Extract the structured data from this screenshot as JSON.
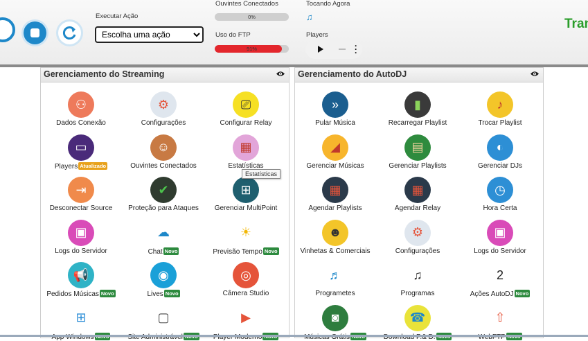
{
  "header": {
    "action_label": "Executar Ação",
    "action_select": "Escolha uma ação",
    "listeners_label": "Ouvintes Conectados",
    "listeners_percent": "0%",
    "listeners_fraction": 0,
    "ftp_label": "Uso do FTP",
    "ftp_percent": "91%",
    "ftp_fraction": 0.91,
    "playing_label": "Tocando Agora",
    "players_label": "Players",
    "right_text": "Tran",
    "colors": {
      "accent_blue": "#1e88c9",
      "ftp_bar": "#e3262c",
      "green_text": "#2a9d2a"
    }
  },
  "streaming": {
    "title": "Gerenciamento do Streaming",
    "tiles": [
      {
        "label": "Dados Conexão",
        "icon": "connection-icon"
      },
      {
        "label": "Configurações",
        "icon": "gear-icon"
      },
      {
        "label": "Configurar Relay",
        "icon": "relay-icon"
      },
      {
        "label": "Players",
        "icon": "player-icon",
        "badge": "Atualizado"
      },
      {
        "label": "Ouvintes Conectados",
        "icon": "listeners-icon"
      },
      {
        "label": "Estatísticas",
        "icon": "stats-icon"
      },
      {
        "label": "Desconectar Source",
        "icon": "disconnect-icon"
      },
      {
        "label": "Proteção para Ataques",
        "icon": "shield-icon"
      },
      {
        "label": "Gerenciar MultiPoint",
        "icon": "multipoint-icon"
      },
      {
        "label": "Logs do Servidor",
        "icon": "logs-icon"
      },
      {
        "label": "Chat",
        "icon": "chat-icon",
        "badge": "Novo"
      },
      {
        "label": "Previsão Tempo",
        "icon": "weather-icon",
        "badge": "Novo"
      },
      {
        "label": "Pedidos Músicas",
        "icon": "megaphone-icon",
        "badge": "Novo"
      },
      {
        "label": "Lives",
        "icon": "live-icon",
        "badge": "Novo"
      },
      {
        "label": "Câmera Studio",
        "icon": "camera-icon"
      },
      {
        "label": "App Windows",
        "icon": "windows-icon",
        "badge": "Novo"
      },
      {
        "label": "Site Administrável",
        "icon": "site-icon",
        "badge": "Novo"
      },
      {
        "label": "Player Moderno",
        "icon": "modern-player-icon",
        "badge": "Novo"
      }
    ],
    "tooltip": "Estatísticas"
  },
  "autodj": {
    "title": "Gerenciamento do AutoDJ",
    "tiles": [
      {
        "label": "Pular Música",
        "icon": "skip-icon"
      },
      {
        "label": "Recarregar Playlist",
        "icon": "reload-playlist-icon"
      },
      {
        "label": "Trocar Playlist",
        "icon": "swap-playlist-icon"
      },
      {
        "label": "Gerenciar Músicas",
        "icon": "music-manage-icon"
      },
      {
        "label": "Gerenciar Playlists",
        "icon": "playlist-manage-icon"
      },
      {
        "label": "Gerenciar DJs",
        "icon": "dj-icon"
      },
      {
        "label": "Agendar Playlists",
        "icon": "calendar-icon"
      },
      {
        "label": "Agendar Relay",
        "icon": "calendar-icon"
      },
      {
        "label": "Hora Certa",
        "icon": "clock-icon"
      },
      {
        "label": "Vinhetas & Comerciais",
        "icon": "jingle-icon"
      },
      {
        "label": "Configurações",
        "icon": "gear-icon"
      },
      {
        "label": "Logs do Servidor",
        "icon": "logs-icon"
      },
      {
        "label": "Programetes",
        "icon": "programs-icon"
      },
      {
        "label": "Programas",
        "icon": "music-note-icon"
      },
      {
        "label": "Ações AutoDJ",
        "icon": "calendar-day-icon",
        "badge": "Novo"
      },
      {
        "label": "Músicas Grátis",
        "icon": "free-music-icon",
        "badge": "Novo"
      },
      {
        "label": "Download P.& D.",
        "icon": "download-icon",
        "badge": "Novo"
      },
      {
        "label": "WebFTP",
        "icon": "cloud-upload-icon",
        "badge": "Novo"
      }
    ]
  }
}
